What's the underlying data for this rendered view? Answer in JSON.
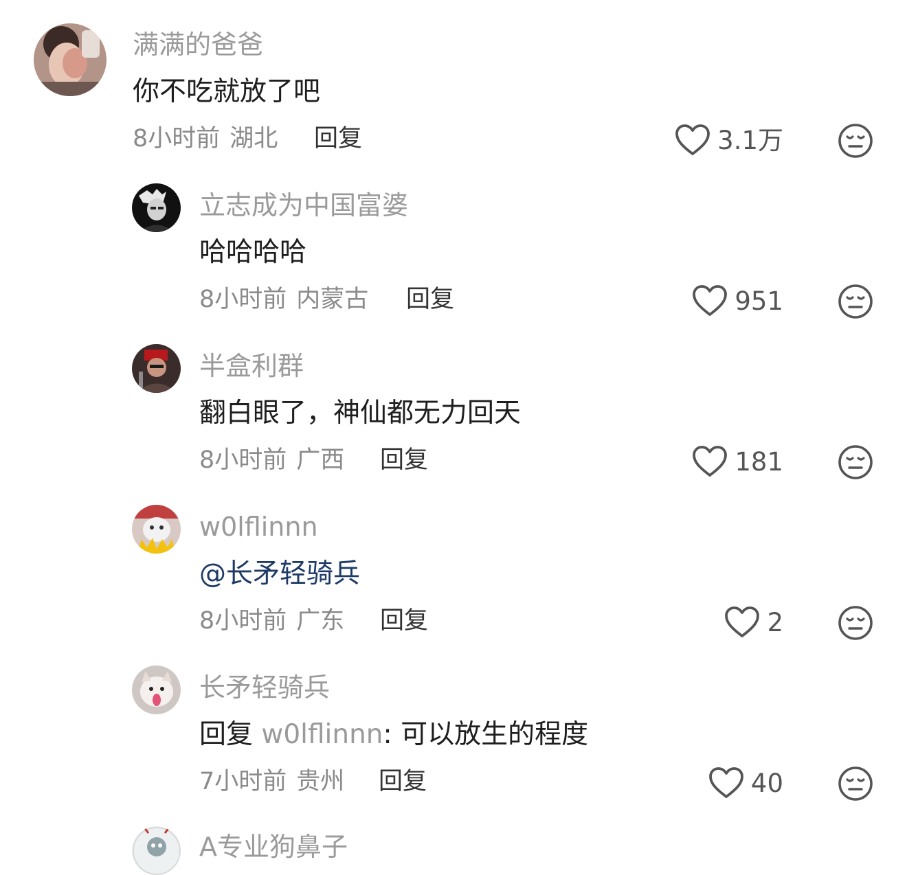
{
  "comments": [
    {
      "username": "满满的爸爸",
      "text": "你不吃就放了吧",
      "time": "8小时前",
      "location": "湖北",
      "reply_label": "回复",
      "likes": "3.1万"
    },
    {
      "username": "立志成为中国富婆",
      "text": "哈哈哈哈",
      "time": "8小时前",
      "location": "内蒙古",
      "reply_label": "回复",
      "likes": "951"
    },
    {
      "username": "半盒利群",
      "text": "翻白眼了，神仙都无力回天",
      "time": "8小时前",
      "location": "广西",
      "reply_label": "回复",
      "likes": "181"
    },
    {
      "username": "w0lflinnn",
      "text": "@长矛轻骑兵",
      "time": "8小时前",
      "location": "广东",
      "reply_label": "回复",
      "likes": "2"
    },
    {
      "username": "长矛轻骑兵",
      "reply_prefix": "回复",
      "reply_target": "w0lflinnn",
      "text": ": 可以放生的程度",
      "time": "7小时前",
      "location": "贵州",
      "reply_label": "回复",
      "likes": "40"
    }
  ],
  "partial_comment": {
    "username": "A专业狗鼻子"
  },
  "icons": {
    "like": "heart-outline-icon",
    "dislike": "meh-face-icon"
  },
  "colors": {
    "username": "#9a9a9a",
    "text": "#1e1e1e",
    "meta": "#8a8a8a",
    "mention": "#1d3a66",
    "icon": "#555555"
  }
}
